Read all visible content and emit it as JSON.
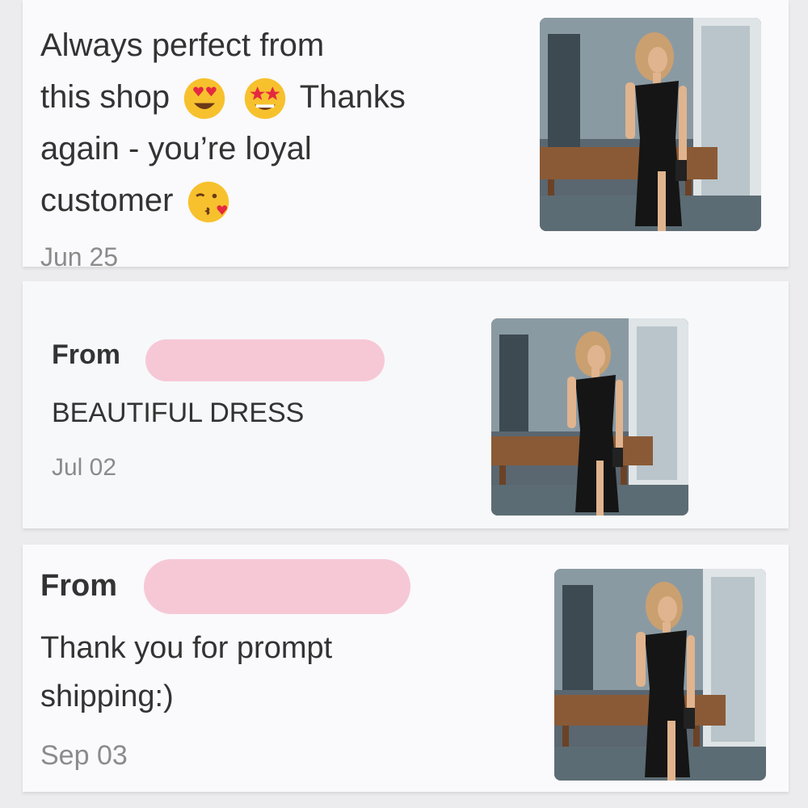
{
  "reviews": [
    {
      "message_lines": [
        "Always perfect from",
        "this shop",
        "Thanks",
        "again - you’re loyal",
        "customer"
      ],
      "emojis": [
        "heart-eyes-emoji",
        "star-struck-emoji",
        "kissing-heart-emoji"
      ],
      "date": "Jun 25",
      "photo": "black-dress-photo"
    },
    {
      "from_label": "From",
      "from_name_redacted": true,
      "message": "BEAUTIFUL DRESS",
      "date": "Jul 02",
      "photo": "black-dress-photo"
    },
    {
      "from_label": "From",
      "from_name_redacted": true,
      "message_lines": [
        "Thank you for prompt",
        "shipping:)"
      ],
      "date": "Sep 03",
      "photo": "black-dress-photo"
    }
  ],
  "colors": {
    "background": "#ececee",
    "card": "#faf9fb",
    "redaction": "#f6c8d6",
    "date_text": "#8b8b8b"
  }
}
